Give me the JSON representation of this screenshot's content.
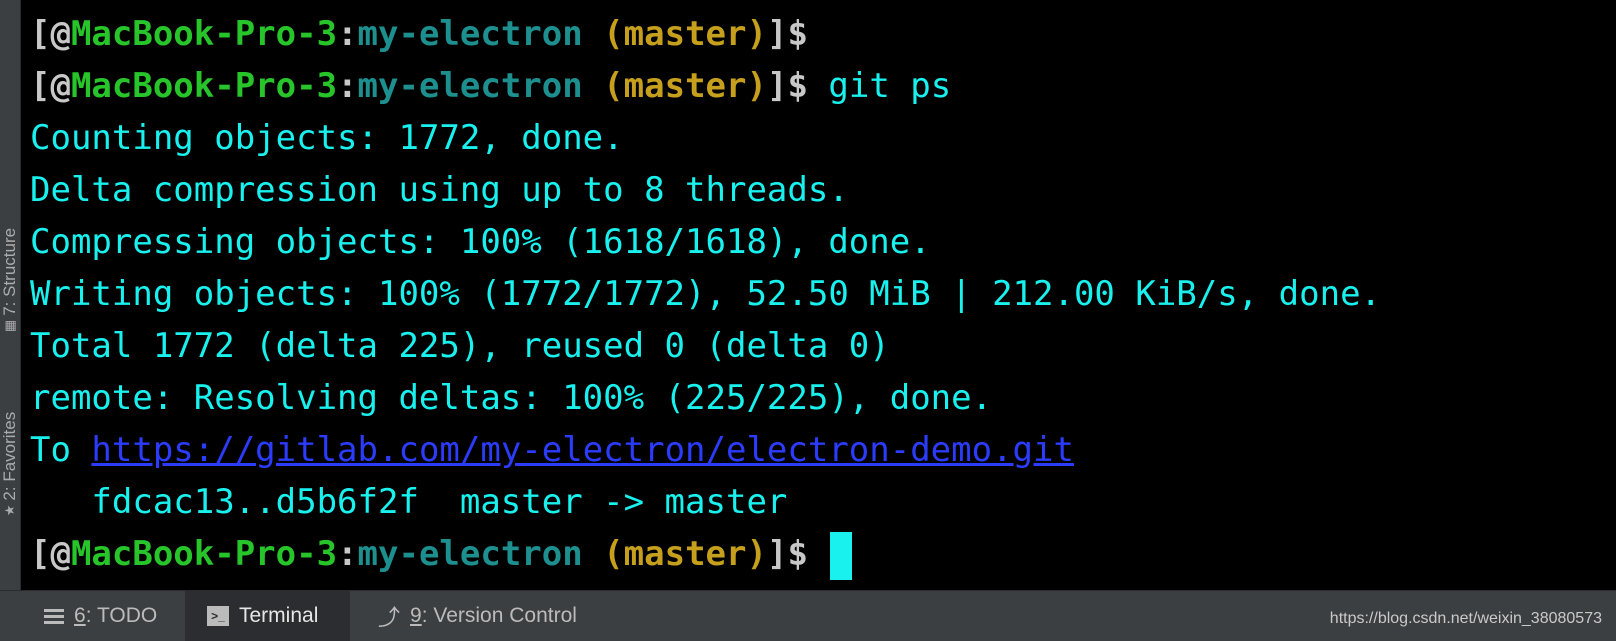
{
  "sidebar": {
    "structure_label": "7: Structure",
    "favorites_label": "2: Favorites"
  },
  "terminal": {
    "prompt_user": "[@",
    "prompt_host": "MacBook-Pro-3",
    "prompt_colon": ":",
    "prompt_dir": "my-electron",
    "prompt_branch": "(master)",
    "prompt_end": "]$",
    "command": "git ps",
    "output": [
      "Counting objects: 1772, done.",
      "Delta compression using up to 8 threads.",
      "Compressing objects: 100% (1618/1618), done.",
      "Writing objects: 100% (1772/1772), 52.50 MiB | 212.00 KiB/s, done.",
      "Total 1772 (delta 225), reused 0 (delta 0)",
      "remote: Resolving deltas: 100% (225/225), done."
    ],
    "to_prefix": "To ",
    "remote_url": "https://gitlab.com/my-electron/electron-demo.git",
    "ref_update": "   fdcac13..d5b6f2f  master -> master"
  },
  "bottombar": {
    "todo": {
      "num": "6",
      "label": ": TODO"
    },
    "terminal": {
      "label": "Terminal"
    },
    "vcs": {
      "num": "9",
      "label": ": Version Control"
    }
  },
  "watermark": "https://blog.csdn.net/weixin_38080573",
  "colors": {
    "background": "#000000",
    "host": "#27c52a",
    "dir": "#1d8f8f",
    "branch": "#c6a01c",
    "output": "#19f1ef",
    "link": "#2b3cff"
  }
}
